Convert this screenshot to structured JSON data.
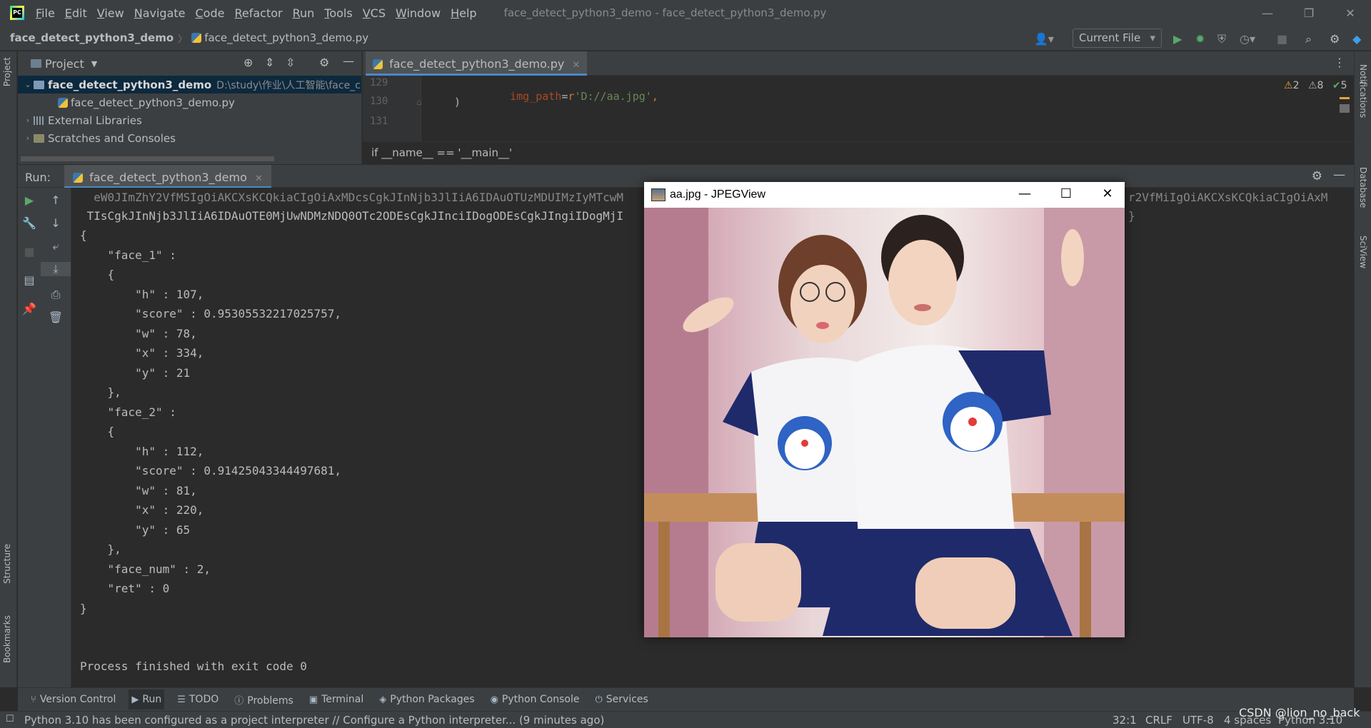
{
  "menu": [
    "File",
    "Edit",
    "View",
    "Navigate",
    "Code",
    "Refactor",
    "Run",
    "Tools",
    "VCS",
    "Window",
    "Help"
  ],
  "window_title": "face_detect_python3_demo - face_detect_python3_demo.py",
  "navbar": {
    "project": "face_detect_python3_demo",
    "file": "face_detect_python3_demo.py",
    "run_config": "Current File"
  },
  "left_strip": {
    "project": "Project",
    "structure": "Structure",
    "bookmarks": "Bookmarks"
  },
  "right_strip": {
    "notifications": "Notifications",
    "database": "Database",
    "sciview": "SciView"
  },
  "project_panel": {
    "title": "Project",
    "root": "face_detect_python3_demo",
    "root_path": "D:\\study\\作业\\人工智能\\face_c",
    "file": "face_detect_python3_demo.py",
    "ext_libs": "External Libraries",
    "scratches": "Scratches and Consoles"
  },
  "editor": {
    "tab": "face_detect_python3_demo.py",
    "lines": [
      {
        "num": "129",
        "param": "img_path",
        "eq": "=",
        "prefix": "r",
        "str": "'D://aa.jpg'",
        "tail": ","
      },
      {
        "num": "130",
        "text": ")"
      },
      {
        "num": "131",
        "text": ""
      }
    ],
    "inspections": {
      "warn": "2",
      "weak": "8",
      "ok": "5"
    },
    "breadcrumb": "if __name__ == '__main__'"
  },
  "run": {
    "label": "Run:",
    "tab": "face_detect_python3_demo",
    "console": [
      "  eW0JImZhY2VfMSIgOiAKCXsKCQkiaCIgOiAxMDcsCgkJInNjb3JlIiA6IDAuOTUzMDUIMzIyMTcwM",
      " TIsCgkJInNjb3JlIiA6IDAuOTE0MjUwNDMzNDQ0OTc2ODEsCgkJInciIDogODEsCgkJIngiIDogMjI",
      "{",
      "    \"face_1\" :",
      "    {",
      "        \"h\" : 107,",
      "        \"score\" : 0.95305532217025757,",
      "        \"w\" : 78,",
      "        \"x\" : 334,",
      "        \"y\" : 21",
      "    },",
      "    \"face_2\" :",
      "    {",
      "        \"h\" : 112,",
      "        \"score\" : 0.91425043344497681,",
      "        \"w\" : 81,",
      "        \"x\" : 220,",
      "        \"y\" : 65",
      "    },",
      "    \"face_num\" : 2,",
      "    \"ret\" : 0",
      "}",
      "",
      "",
      "Process finished with exit code 0"
    ],
    "console_right_fragment_1": "r2VfMiIgOiAKCXsKCQkiaCIgOiAxM",
    "console_right_fragment_2": "}"
  },
  "jpegview": {
    "title": "aa.jpg - JPEGView",
    "minimize": "—",
    "maximize": "☐",
    "close": "✕"
  },
  "bottom_tools": [
    "Version Control",
    "Run",
    "TODO",
    "Problems",
    "Terminal",
    "Python Packages",
    "Python Console",
    "Services"
  ],
  "status": {
    "message": "Python 3.10 has been configured as a project interpreter // Configure a Python interpreter... (9 minutes ago)",
    "position": "32:1",
    "line_sep": "CRLF",
    "encoding": "UTF-8",
    "indent": "4 spaces",
    "interpreter": "Python 3.10",
    "watermark": "CSDN @lion_no_back"
  },
  "colors": {
    "keyword_param": "#aa4926",
    "string": "#6a8759",
    "accent": "#4a88c7"
  }
}
